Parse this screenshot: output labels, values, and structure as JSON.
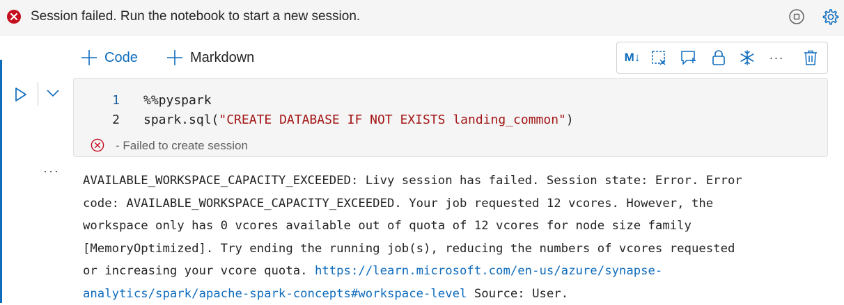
{
  "error_banner": {
    "message": "Session failed. Run the notebook to start a new session.",
    "icons": [
      "error-circle-icon",
      "stop-circle-icon",
      "gear-icon"
    ]
  },
  "add_buttons": {
    "code": "Code",
    "markdown": "Markdown"
  },
  "cell_toolbar": {
    "items": [
      "markdown-toggle-icon",
      "clear-output-icon",
      "add-comment-icon",
      "lock-icon",
      "freeze-icon",
      "more-icon",
      "delete-icon"
    ],
    "markdown_label": "M↓",
    "more_label": "···"
  },
  "code_cell": {
    "lines": [
      {
        "number": "1",
        "text": "%%pyspark"
      },
      {
        "number": "2",
        "prefix": "spark.sql(",
        "string": "\"CREATE DATABASE IF NOT EXISTS landing_common\"",
        "suffix": ")"
      }
    ],
    "status": "- Failed to create session"
  },
  "output": {
    "more_label": "···",
    "lines": [
      "AVAILABLE_WORKSPACE_CAPACITY_EXCEEDED: Livy session has failed. Session state: Error. Error",
      "code: AVAILABLE_WORKSPACE_CAPACITY_EXCEEDED. Your job requested 12 vcores. However, the",
      "workspace only has 0 vcores available out of quota of 12 vcores for node size family",
      "[MemoryOptimized]. Try ending the running job(s), reducing the numbers of vcores requested",
      "or increasing your vcore quota. "
    ],
    "link_part1": "https://learn.microsoft.com/en-us/azure/synapse-",
    "link_part2": "analytics/spark/apache-spark-concepts#workspace-level",
    "tail": " Source: User."
  },
  "colors": {
    "accent": "#0f6cbd",
    "error": "#c50f1f",
    "string": "#a31515"
  }
}
